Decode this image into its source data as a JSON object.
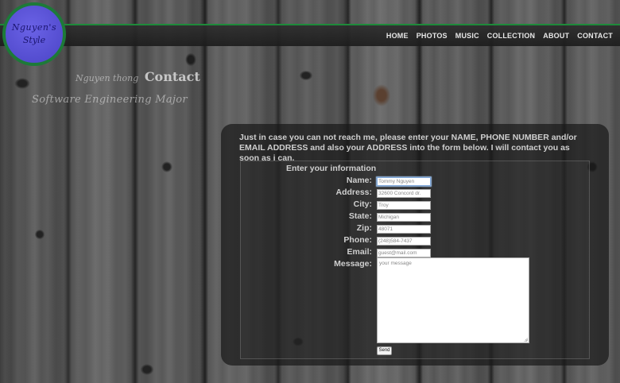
{
  "site": {
    "logo_line1": "Nguyen's",
    "logo_line2": "Style",
    "owner_name": "Nguyen thong",
    "page_title": "Contact",
    "subtitle": "Software Engineering Major"
  },
  "nav": {
    "items": [
      "HOME",
      "PHOTOS",
      "MUSIC",
      "COLLECTION",
      "ABOUT",
      "CONTACT"
    ]
  },
  "contact": {
    "intro": "Just in case you can not reach me, please enter your NAME, PHONE NUMBER and/or EMAIL ADDRESS and also your ADDRESS into the form below. I will contact you as soon as i can.",
    "form_heading": "Enter your information",
    "fields": [
      {
        "label": "Name:",
        "value": "Tommy Nguyen"
      },
      {
        "label": "Address:",
        "value": "32600 Concord dr."
      },
      {
        "label": "City:",
        "value": "Troy"
      },
      {
        "label": "State:",
        "value": "Michigan"
      },
      {
        "label": "Zip:",
        "value": "48071"
      },
      {
        "label": "Phone:",
        "value": "(248)584-7437"
      },
      {
        "label": "Email:",
        "value": "guest@mail.com"
      }
    ],
    "message_label": "Message:",
    "message_placeholder": "your message",
    "send_label": "Send"
  },
  "colors": {
    "accent_green": "#1d7a38",
    "logo_purple": "#5a52d6",
    "navbar": "#222222"
  }
}
